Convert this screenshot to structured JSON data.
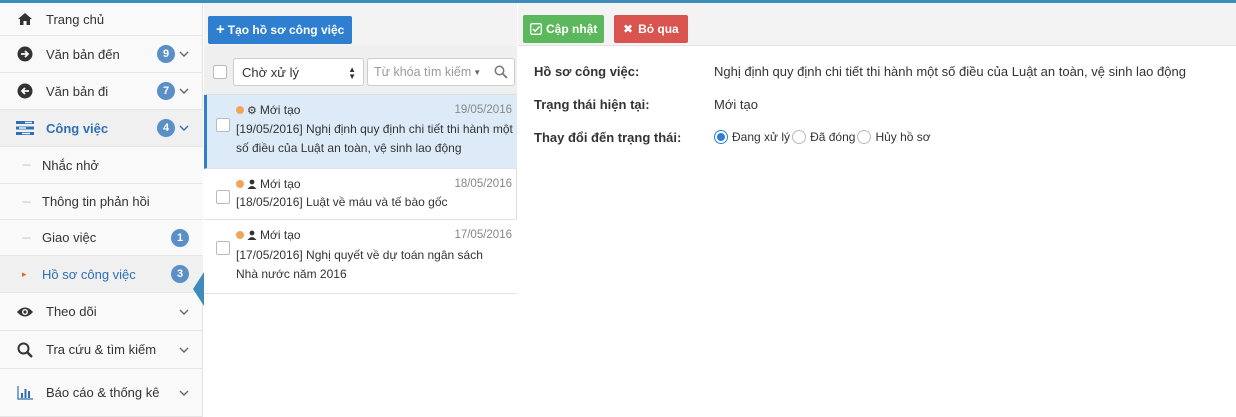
{
  "sidebar": {
    "items": [
      {
        "label": "Trang chủ",
        "icon": "home-icon"
      },
      {
        "label": "Văn bản đến",
        "icon": "arrow-right-circle-icon",
        "badge": "9"
      },
      {
        "label": "Văn bản đi",
        "icon": "arrow-left-circle-icon",
        "badge": "7"
      },
      {
        "label": "Công việc",
        "icon": "tasks-icon",
        "badge": "4"
      }
    ],
    "subitems": [
      {
        "label": "Nhắc nhở"
      },
      {
        "label": "Thông tin phản hồi"
      },
      {
        "label": "Giao việc",
        "badge": "1"
      },
      {
        "label": "Hồ sơ công việc",
        "badge": "3"
      }
    ],
    "bottom_items": [
      {
        "label": "Theo dõi",
        "icon": "eye-icon"
      },
      {
        "label": "Tra cứu & tìm kiếm",
        "icon": "search-icon"
      },
      {
        "label": "Báo cáo & thống kê",
        "icon": "bar-chart-icon"
      }
    ]
  },
  "list": {
    "create_label": "Tạo hồ sơ công việc",
    "filter_selected": "Chờ xử lý",
    "search_placeholder": "Từ khóa tìm kiếm",
    "rows": [
      {
        "status": "Mới tạo",
        "date": "19/05/2016",
        "title": "[19/05/2016] Nghị định quy định chi tiết thi hành một số điều của Luật an toàn, vệ sinh lao động"
      },
      {
        "status": "Mới tạo",
        "date": "18/05/2016",
        "title": "[18/05/2016] Luật về máu và tế bào gốc"
      },
      {
        "status": "Mới tạo",
        "date": "17/05/2016",
        "title": "[17/05/2016] Nghị quyết về dự toán ngân sách Nhà nước năm 2016"
      }
    ]
  },
  "detail": {
    "update_label": "Cập nhật",
    "cancel_label": "Bỏ qua",
    "profile_label": "Hồ sơ công việc:",
    "profile_value": "Nghị định quy định chi tiết thi hành một số điều của Luật an toàn, vệ sinh lao động",
    "status_label": "Trạng thái hiện tại:",
    "status_value": "Mới tạo",
    "change_label": "Thay đổi đến trạng thái:",
    "options": [
      "Đang xử lý",
      "Đã đóng",
      "Hủy hồ sơ"
    ],
    "selected_option": "Đang xử lý"
  },
  "colors": {
    "accent": "#2f7fd0",
    "badge": "#5a8fc7",
    "update": "#5cb85c",
    "cancel": "#d9534f",
    "status_dot": "#f3a45a"
  }
}
